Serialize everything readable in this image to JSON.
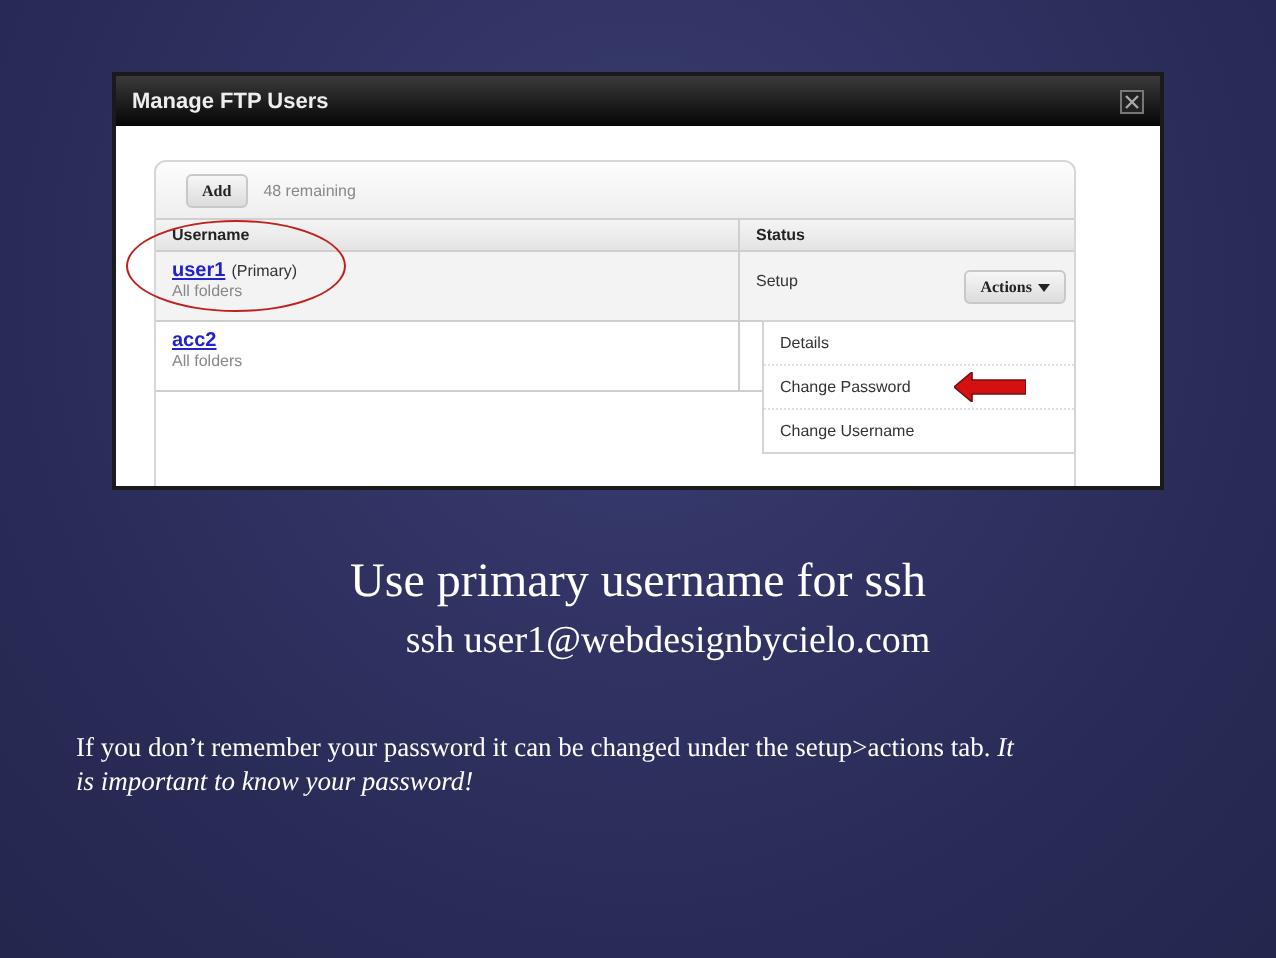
{
  "window": {
    "title": "Manage FTP Users"
  },
  "toolbar": {
    "add_button": "Add",
    "remaining": "48 remaining"
  },
  "table": {
    "columns": [
      "Username",
      "Status"
    ],
    "rows": [
      {
        "username": "user1",
        "note": "(Primary)",
        "folders": "All folders",
        "status": "Setup",
        "actions": "Actions",
        "circled": true
      },
      {
        "username": "acc2",
        "folders": "All folders",
        "circled": false
      }
    ]
  },
  "actions_menu": {
    "items": [
      {
        "label": "Details",
        "pointed": false
      },
      {
        "label": "Change Password",
        "pointed": true
      },
      {
        "label": "Change Username",
        "pointed": false
      }
    ]
  },
  "slide": {
    "heading": "Use primary username for ssh",
    "subheading": "ssh user1@webdesignbycielo.com",
    "note": "If you don’t remember your password it can be changed under the setup>actions tab. *It is important to know your password!*"
  }
}
